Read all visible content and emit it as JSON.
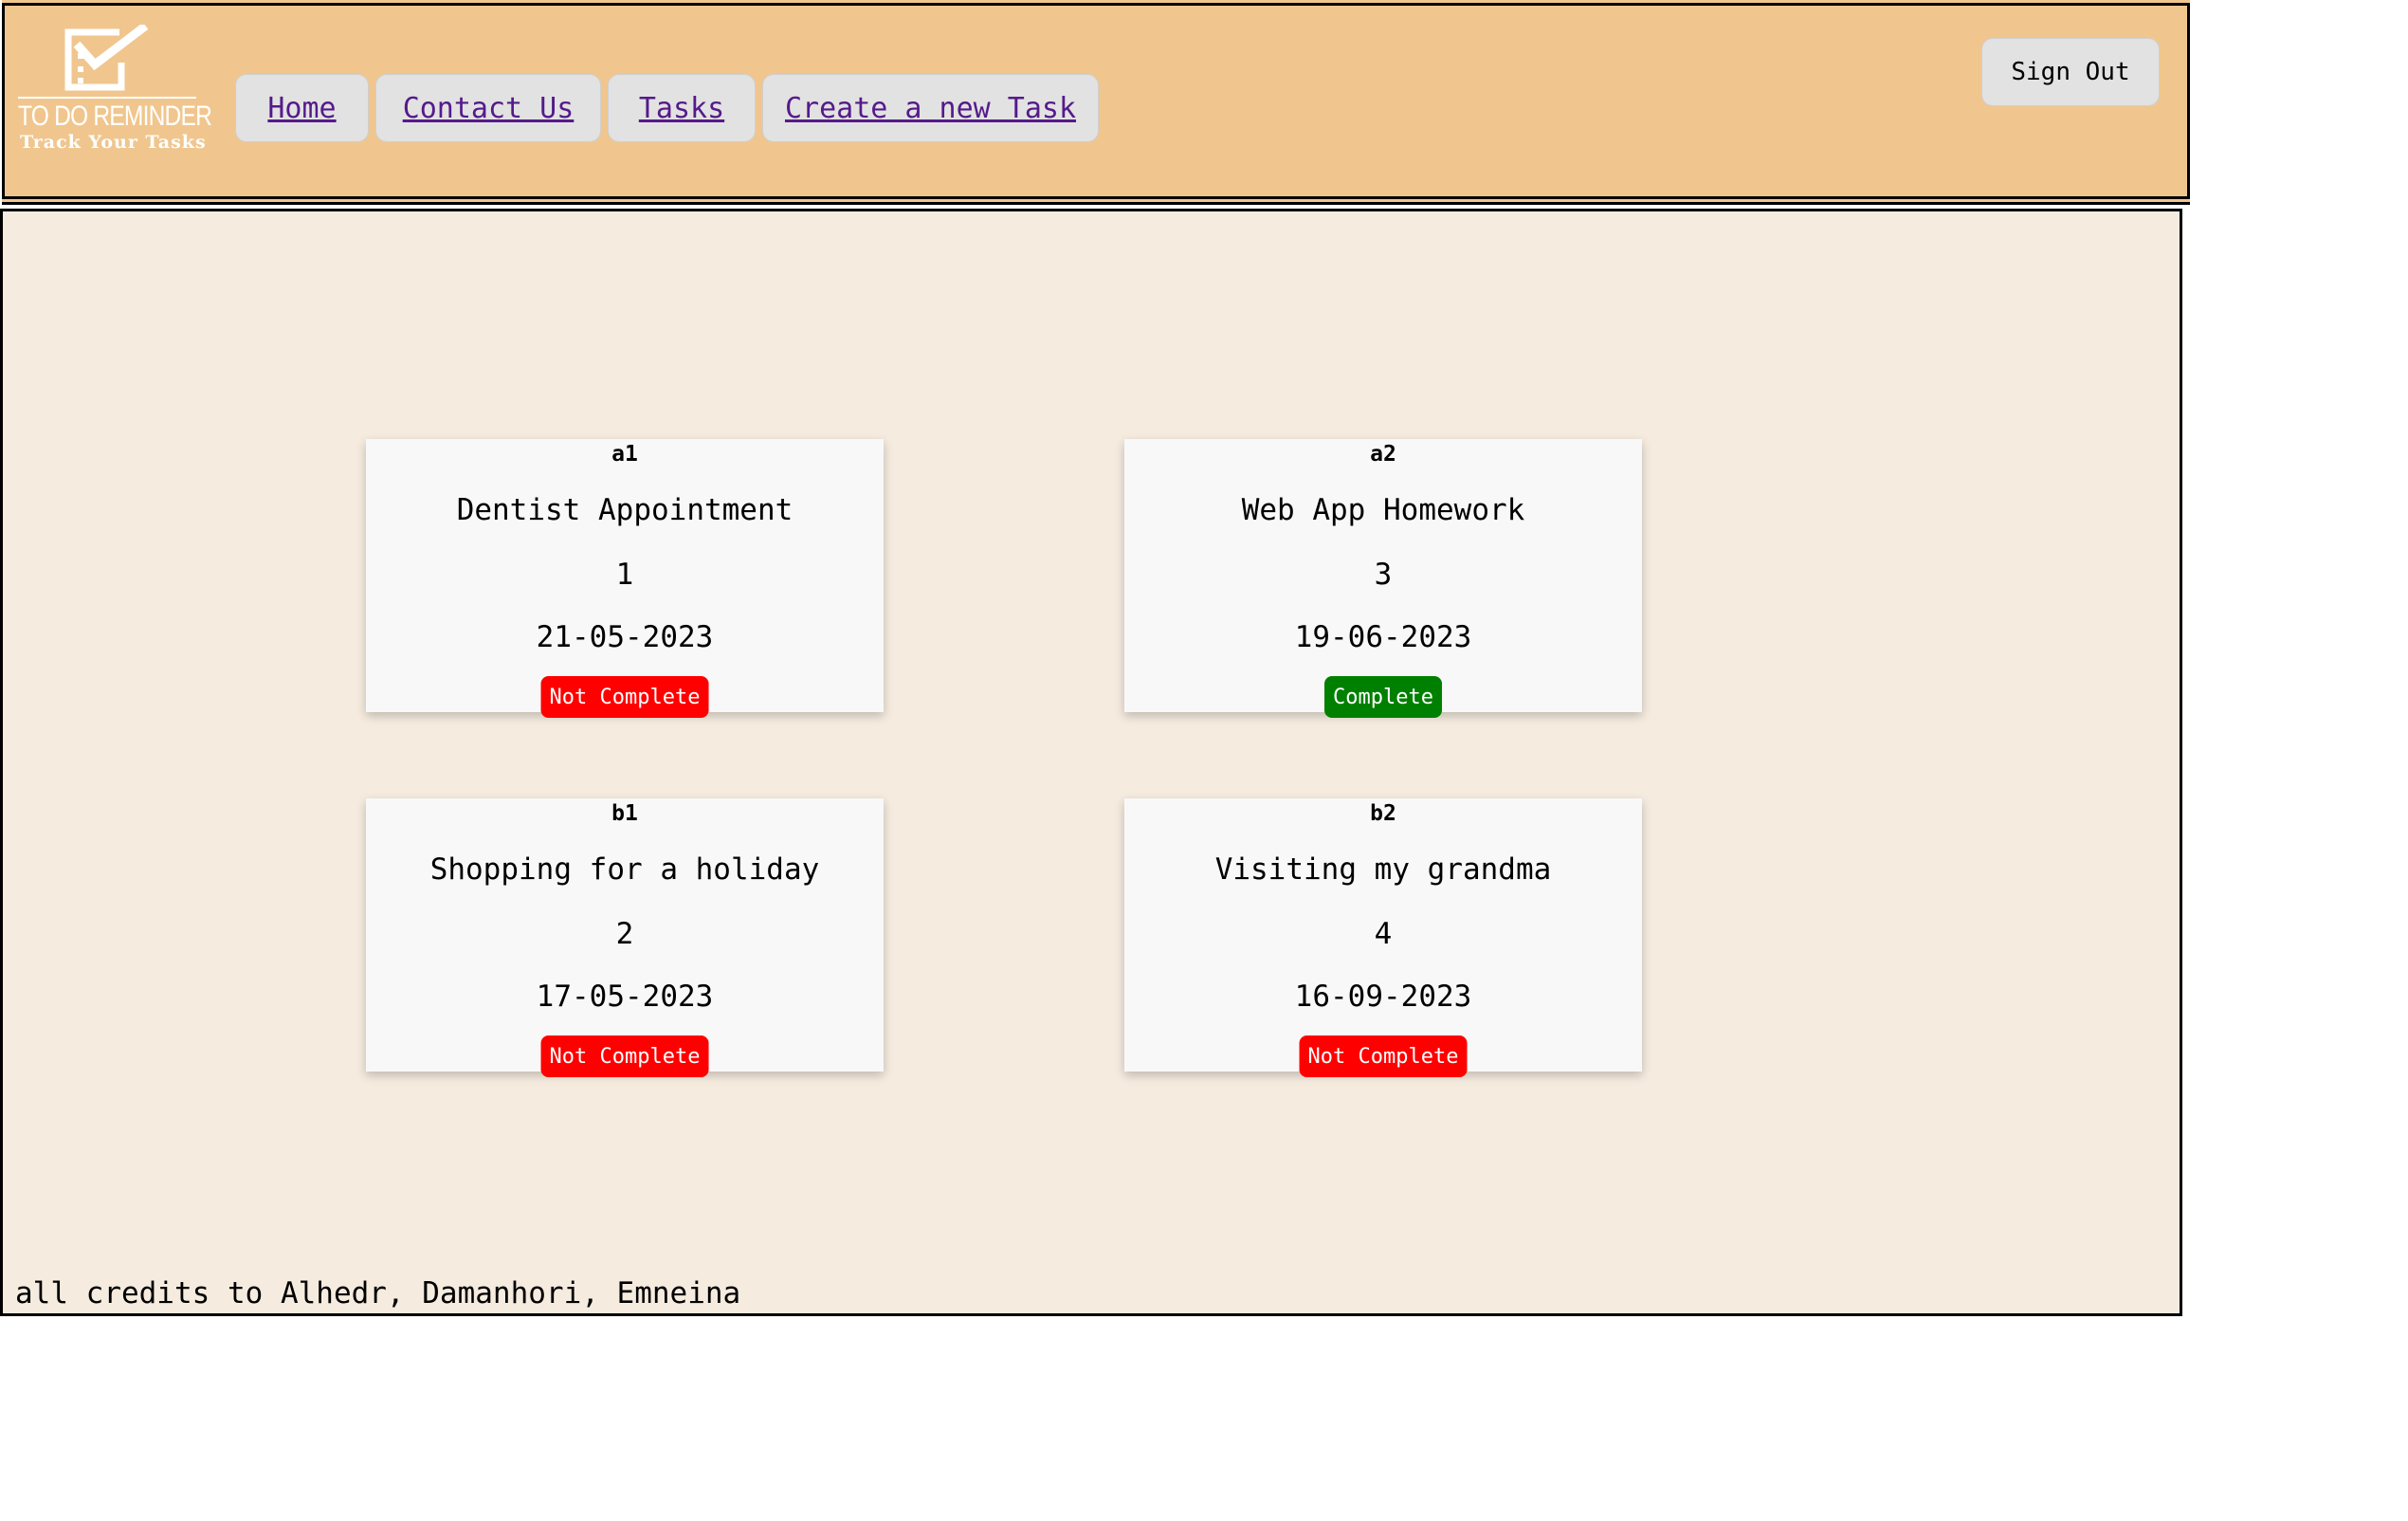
{
  "brand": {
    "title": "TO DO REMINDER",
    "subtitle": "Track Your Tasks",
    "icon": "checkbox-list-icon"
  },
  "nav": [
    {
      "label": "Home"
    },
    {
      "label": "Contact Us"
    },
    {
      "label": "Tasks"
    },
    {
      "label": "Create a new Task"
    }
  ],
  "signout_label": "Sign Out",
  "tasks": [
    {
      "code": "a1",
      "title": "Dentist Appointment",
      "priority": "1",
      "date": "21-05-2023",
      "status": "Not Complete"
    },
    {
      "code": "a2",
      "title": "Web App Homework",
      "priority": "3",
      "date": "19-06-2023",
      "status": "Complete"
    },
    {
      "code": "b1",
      "title": "Shopping for a holiday",
      "priority": "2",
      "date": "17-05-2023",
      "status": "Not Complete"
    },
    {
      "code": "b2",
      "title": "Visiting my grandma",
      "priority": "4",
      "date": "16-09-2023",
      "status": "Not Complete"
    }
  ],
  "footer": "all credits to Alhedr, Damanhori, Emneina",
  "colors": {
    "header_bg": "#f0c68e",
    "main_bg": "#f5ebdf",
    "status_incomplete": "#ff0000",
    "status_complete": "#008000"
  }
}
